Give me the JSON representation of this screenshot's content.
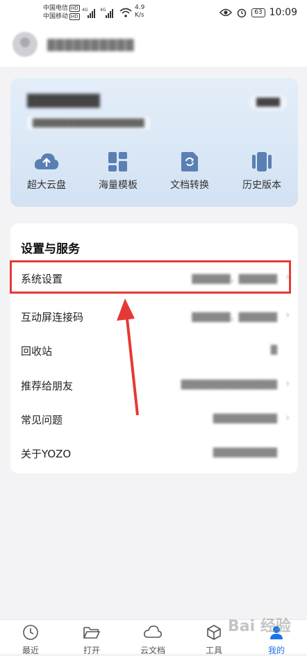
{
  "status_bar": {
    "carrier_1": "中国电信",
    "carrier_2": "中国移动",
    "hd": "HD",
    "network": "4G",
    "speed_value": "4.9",
    "speed_unit": "K/s",
    "battery": "63",
    "time": "10:09"
  },
  "header": {
    "user_name": "██████████"
  },
  "vip_card": {
    "title": "████████",
    "subtitle": "███████████████████",
    "button": "████",
    "features": [
      {
        "label": "超大云盘",
        "icon": "cloud-upload-icon"
      },
      {
        "label": "海量模板",
        "icon": "template-grid-icon"
      },
      {
        "label": "文档转换",
        "icon": "doc-convert-icon"
      },
      {
        "label": "历史版本",
        "icon": "history-version-icon"
      }
    ]
  },
  "settings": {
    "title": "设置与服务",
    "rows": [
      {
        "label": "系统设置",
        "value": "██████，██████",
        "chevron": "›"
      },
      {
        "label": "互动屏连接码",
        "value": "██████，██████",
        "chevron": "›"
      },
      {
        "label": "回收站",
        "value": "█",
        "chevron": ""
      },
      {
        "label": "推荐给朋友",
        "value": "███████████████",
        "chevron": "›"
      },
      {
        "label": "常见问题",
        "value": "██████████",
        "chevron": "›"
      },
      {
        "label": "关于YOZO",
        "value": "██████████",
        "chevron": ""
      }
    ]
  },
  "annotation": {
    "highlight_color": "#e53935"
  },
  "tabbar": {
    "tabs": [
      {
        "label": "最近",
        "icon": "clock-icon",
        "active": false
      },
      {
        "label": "打开",
        "icon": "folder-icon",
        "active": false
      },
      {
        "label": "云文档",
        "icon": "cloud-icon",
        "active": false
      },
      {
        "label": "工具",
        "icon": "toolbox-icon",
        "active": false
      },
      {
        "label": "我的",
        "icon": "profile-icon",
        "active": true
      }
    ]
  },
  "watermark": "Bai 经验",
  "colors": {
    "accent": "#1a73e8",
    "icon_blue": "#5a7fb3"
  }
}
